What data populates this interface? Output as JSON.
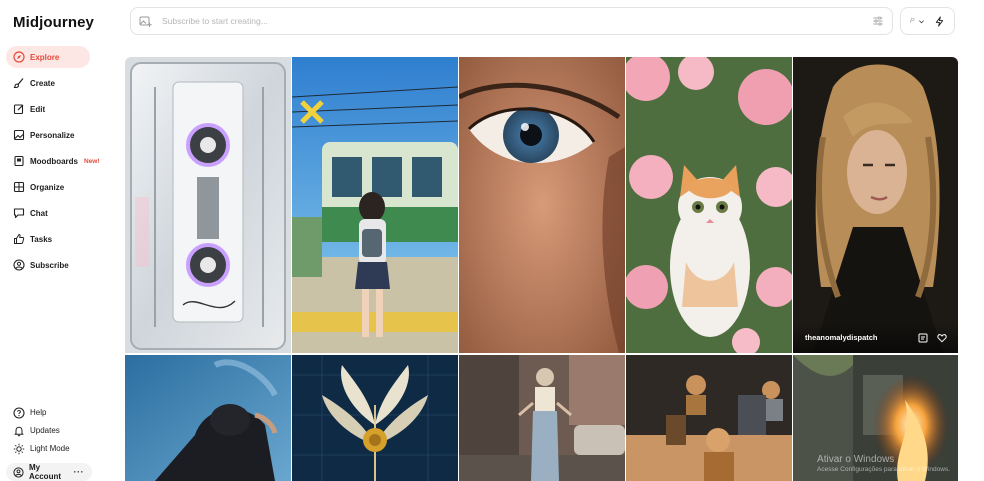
{
  "app": {
    "title": "Midjourney"
  },
  "sidebar": {
    "items": [
      {
        "label": "Explore",
        "icon": "compass-icon",
        "active": true
      },
      {
        "label": "Create",
        "icon": "brush-icon"
      },
      {
        "label": "Edit",
        "icon": "edit-icon"
      },
      {
        "label": "Personalize",
        "icon": "personalize-icon"
      },
      {
        "label": "Moodboards",
        "icon": "moodboard-icon",
        "badge": "New!"
      },
      {
        "label": "Organize",
        "icon": "grid-icon"
      },
      {
        "label": "Chat",
        "icon": "chat-icon"
      },
      {
        "label": "Tasks",
        "icon": "thumbs-up-icon"
      },
      {
        "label": "Subscribe",
        "icon": "subscribe-icon"
      }
    ],
    "bottom": [
      {
        "label": "Help",
        "icon": "help-icon"
      },
      {
        "label": "Updates",
        "icon": "bell-icon"
      },
      {
        "label": "Light Mode",
        "icon": "sun-icon"
      }
    ],
    "account": {
      "label": "My Account",
      "more": "···"
    }
  },
  "search": {
    "placeholder": "Subscribe to start creating..."
  },
  "tools": {
    "param_label": "P"
  },
  "gallery": {
    "hovered_author": "theanomalydispatch",
    "watermark": {
      "line1": "Ativar o Windows",
      "line2": "Acesse Configurações para ativar o Windows."
    }
  },
  "colors": {
    "accent": "#e24a3b",
    "active_bg": "#fde7e4"
  }
}
